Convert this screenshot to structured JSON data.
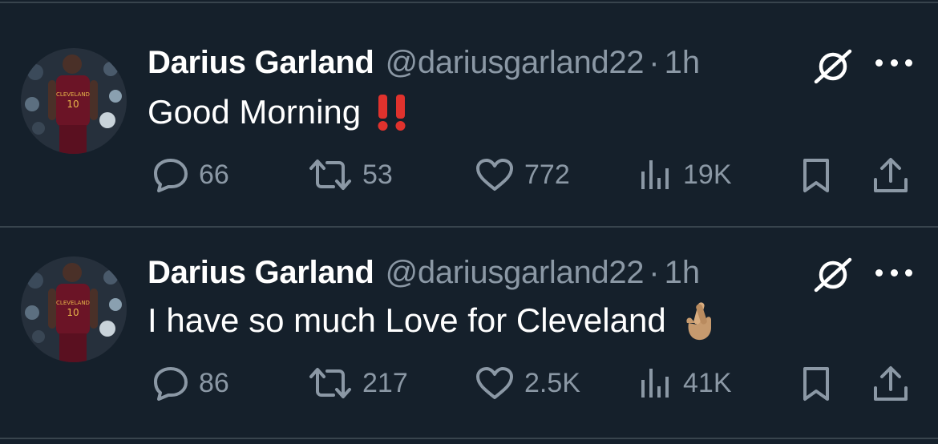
{
  "colors": {
    "background": "#15202b",
    "divider": "#38444d",
    "text_primary": "#ffffff",
    "text_secondary": "#8b98a5",
    "exclamation": "#e0322d"
  },
  "tweets": [
    {
      "display_name": "Darius Garland",
      "handle": "@dariusgarland22",
      "separator": "·",
      "time": "1h",
      "text": "Good Morning",
      "emoji": "‼️",
      "replies": "66",
      "reposts": "53",
      "likes": "772",
      "views": "19K"
    },
    {
      "display_name": "Darius Garland",
      "handle": "@dariusgarland22",
      "separator": "·",
      "time": "1h",
      "text": "I have so much Love for Cleveland",
      "emoji": "🤞🏽",
      "replies": "86",
      "reposts": "217",
      "likes": "2.5K",
      "views": "41K"
    }
  ],
  "icons": {
    "grok": "grok-icon",
    "more": "more-options-icon",
    "reply": "reply-icon",
    "repost": "repost-icon",
    "like": "like-icon",
    "views": "views-icon",
    "bookmark": "bookmark-icon",
    "share": "share-icon"
  }
}
